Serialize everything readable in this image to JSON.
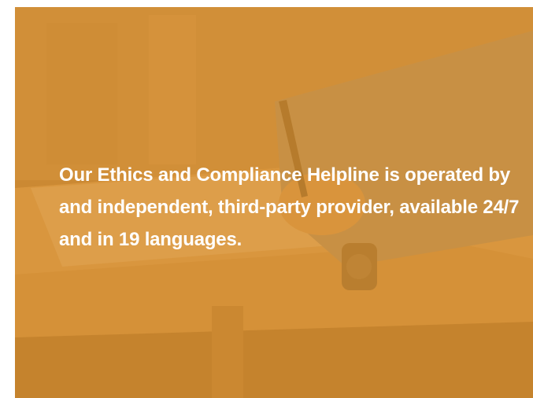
{
  "banner": {
    "message": "Our Ethics and Compliance Helpline is operated by and independent, third-party provider, available 24/7 and in 19 languages.",
    "background_image": "person-writing-at-desk-photo",
    "tint_color": "#de922d",
    "text_color": "#ffffff"
  }
}
